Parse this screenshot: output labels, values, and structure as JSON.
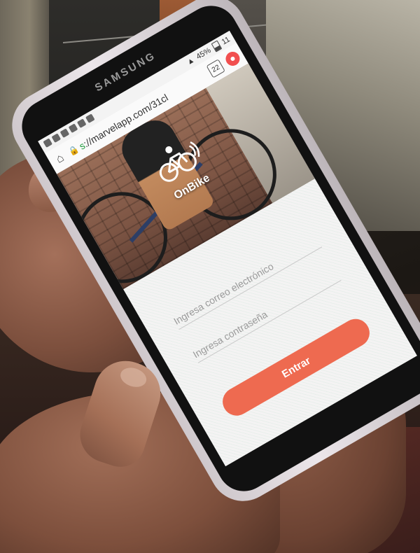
{
  "phone": {
    "brand": "SAMSUNG",
    "status_bar": {
      "battery": "45%",
      "time": "11"
    },
    "browser": {
      "url_scheme": "s",
      "url_rest": "://marvelapp.com/31cl",
      "tab_count": "22",
      "home_icon": "home-icon",
      "menu_icon": "menu-icon"
    },
    "app": {
      "brand_name": "OnBike",
      "logo_icon": "bicycle-icon",
      "email_placeholder": "Ingresa correo electrónico",
      "password_placeholder": "Ingresa contraseña",
      "enter_button": "Entrar"
    }
  },
  "colors": {
    "accent": "#ee6a50",
    "menu_badge": "#f14f4f",
    "lock_green": "#1b9a3a"
  }
}
